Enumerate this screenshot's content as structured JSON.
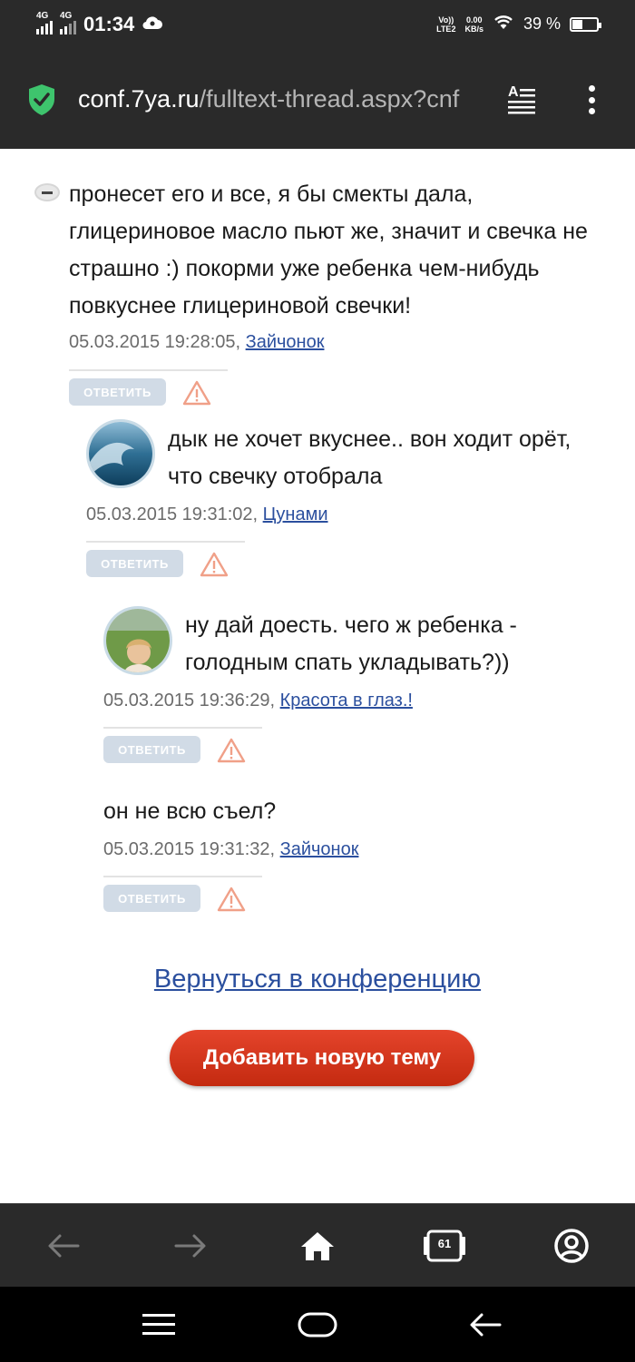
{
  "status_bar": {
    "network1": "4G",
    "network2": "4G",
    "time": "01:34",
    "volte_top": "Vo))",
    "volte_bottom": "LTE2",
    "speed_top": "0.00",
    "speed_bottom": "KB/s",
    "battery_text": "39 %",
    "battery_level": 0.39
  },
  "browser": {
    "url_host": "conf.7ya.ru",
    "url_path": "/fulltext-thread.aspx?cnf",
    "tabs_count": "61"
  },
  "posts": [
    {
      "text": "пронесет его и все, я бы смекты дала, глицериновое масло пьют же, значит и свечка не страшно :) покорми уже ребенка чем-нибудь повкуснее глицериновой свечки!",
      "timestamp": "05.03.2015 19:28:05,",
      "author": "Зайчонок",
      "reply_label": "ОТВЕТИТЬ"
    },
    {
      "text": "дык не хочет вкуснее.. вон ходит орёт, что свечку отобрала",
      "timestamp": "05.03.2015 19:31:02,",
      "author": "Цунами",
      "reply_label": "ОТВЕТИТЬ"
    },
    {
      "text": "ну дай доесть. чего ж ребенка - голодным спать укладывать?))",
      "timestamp": "05.03.2015 19:36:29,",
      "author": "Красота в глаз.!",
      "reply_label": "ОТВЕТИТЬ"
    },
    {
      "text": "он не всю съел?",
      "timestamp": "05.03.2015 19:31:32,",
      "author": "Зайчонок",
      "reply_label": "ОТВЕТИТЬ"
    }
  ],
  "footer": {
    "back_link": "Вернуться в конференцию",
    "new_topic_button": "Добавить новую тему"
  },
  "colors": {
    "link": "#2b4f9e",
    "reply_button": "#d1dbe6",
    "new_topic_button": "#d73419",
    "secure_shield": "#3ec46d"
  },
  "icons": {
    "secure": "shield-check-icon",
    "reader": "reader-mode-icon",
    "menu": "more-vertical-icon",
    "report": "warning-triangle-icon",
    "back": "arrow-left-icon",
    "forward": "arrow-right-icon",
    "home": "home-icon",
    "tabs": "tabs-icon",
    "profile": "account-icon"
  }
}
